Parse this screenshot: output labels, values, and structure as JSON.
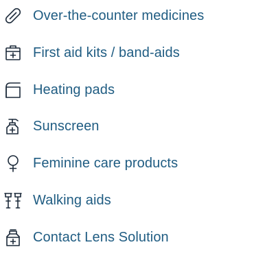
{
  "colors": {
    "text": "#1f5c82",
    "icon": "#1c2a3a"
  },
  "categories": [
    {
      "icon": "pill-icon",
      "label": "Over-the-counter medicines"
    },
    {
      "icon": "first-aid-kit-icon",
      "label": "First aid kits / band-aids"
    },
    {
      "icon": "heating-pad-icon",
      "label": "Heating pads"
    },
    {
      "icon": "sunscreen-bottle-icon",
      "label": "Sunscreen"
    },
    {
      "icon": "female-symbol-icon",
      "label": "Feminine care products"
    },
    {
      "icon": "walking-aid-icon",
      "label": "Walking aids"
    },
    {
      "icon": "lens-solution-bottle-icon",
      "label": "Contact Lens Solution"
    }
  ]
}
